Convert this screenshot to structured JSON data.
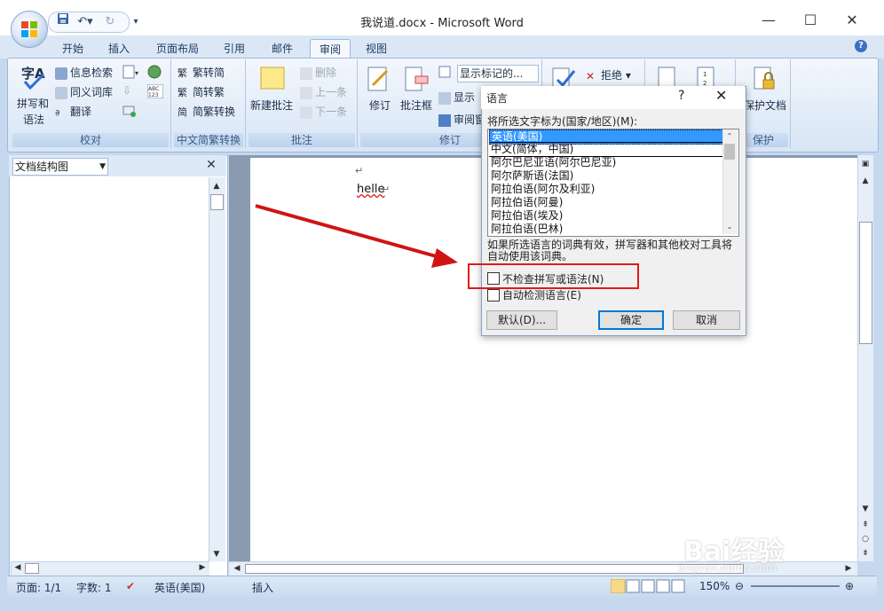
{
  "window": {
    "title": "我说道.docx - Microsoft Word"
  },
  "tabs": [
    "开始",
    "插入",
    "页面布局",
    "引用",
    "邮件",
    "审阅",
    "视图"
  ],
  "active_tab": "审阅",
  "ribbon": {
    "proofing": {
      "spell": "拼写和",
      "spell2": "语法",
      "research": "信息检索",
      "thesaurus": "同义词库",
      "translate": "翻译",
      "label": "校对"
    },
    "chinese": {
      "t2s": "繁转简",
      "s2t": "简转繁",
      "convert": "简繁转换",
      "label": "中文简繁转换"
    },
    "comments": {
      "new": "新建批注",
      "delete": "删除",
      "prev": "上一条",
      "next": "下一条",
      "label": "批注"
    },
    "tracking": {
      "track": "修订",
      "balloons": "批注框",
      "show_markup": "显示标记的...",
      "show": "显示",
      "pane": "审阅窗",
      "label": "修订"
    },
    "changes": {
      "reject": "拒绝"
    },
    "protect": {
      "protect": "保护文档",
      "label": "保护"
    }
  },
  "nav": {
    "combo": "文档结构图"
  },
  "document": {
    "text": "helle"
  },
  "status": {
    "page": "页面: 1/1",
    "words": "字数: 1",
    "lang": "英语(美国)",
    "mode": "插入",
    "zoom": "150%"
  },
  "dialog": {
    "title": "语言",
    "prompt": "将所选文字标为(国家/地区)(M):",
    "languages": [
      "英语(美国)",
      "中文(简体，中国)",
      "阿尔巴尼亚语(阿尔巴尼亚)",
      "阿尔萨斯语(法国)",
      "阿拉伯语(阿尔及利亚)",
      "阿拉伯语(阿曼)",
      "阿拉伯语(埃及)",
      "阿拉伯语(巴林)"
    ],
    "note": "如果所选语言的词典有效，拼写器和其他校对工具将自动使用该词典。",
    "no_check": "不检查拼写或语法(N)",
    "auto_detect": "自动检测语言(E)",
    "default_btn": "默认(D)...",
    "ok_btn": "确定",
    "cancel_btn": "取消"
  },
  "watermark": {
    "text": "Bai经验",
    "url": "jingyan.baidu.com"
  },
  "colors": {
    "accent": "#3399ff",
    "highlight": "#e01b1b",
    "arrow": "#d01414"
  }
}
